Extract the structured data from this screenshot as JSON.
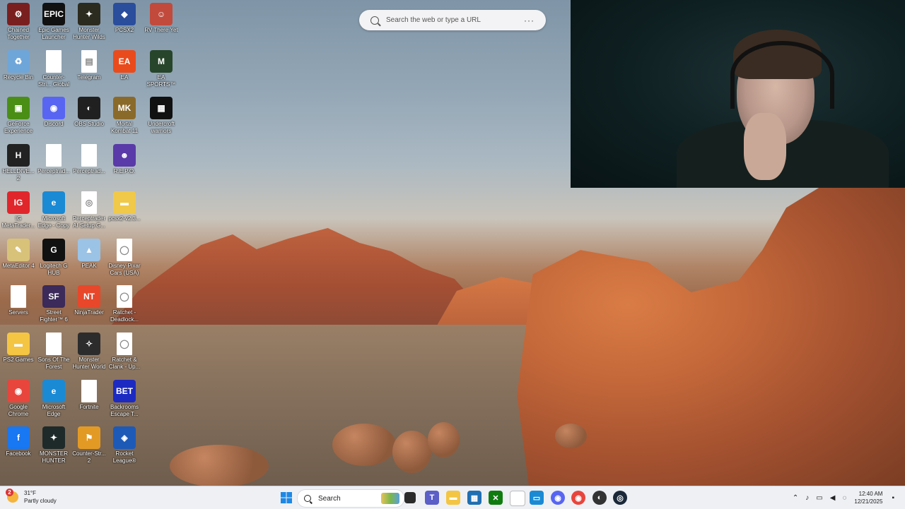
{
  "browser_search": {
    "placeholder": "Search the web or type a URL",
    "more": "···"
  },
  "desktop_icons": [
    {
      "label": "Chained Together",
      "glyph": "⚙",
      "bg": "#7a1f1f"
    },
    {
      "label": "Epic Games Launcher",
      "glyph": "EPIC",
      "bg": "#111111"
    },
    {
      "label": "Monster Hunter Wilds",
      "glyph": "✦",
      "bg": "#2b2b1f"
    },
    {
      "label": "PCSX2",
      "glyph": "◆",
      "bg": "#2a4d9c"
    },
    {
      "label": "RV There Yet",
      "glyph": "☺",
      "bg": "#c24a3c"
    },
    {
      "label": "Recycle Bin",
      "glyph": "♻",
      "bg": "#6fa6d9"
    },
    {
      "label": "Counter-Stri... Global Offe...",
      "glyph": "",
      "bg": "#ffffff"
    },
    {
      "label": "Telegram",
      "glyph": "▤",
      "bg": "#ffffff"
    },
    {
      "label": "EA",
      "glyph": "EA",
      "bg": "#ea4b1c"
    },
    {
      "label": "EA SPORTS™ Madden N...",
      "glyph": "M",
      "bg": "#27452a"
    },
    {
      "label": "GeForce Experience",
      "glyph": "▣",
      "bg": "#4a8e16"
    },
    {
      "label": "Discord",
      "glyph": "◉",
      "bg": "#5865f2"
    },
    {
      "label": "OBS Studio",
      "glyph": "◐",
      "bg": "#202020"
    },
    {
      "label": "Mortal Kombat 11",
      "glyph": "MK",
      "bg": "#8a6a2a"
    },
    {
      "label": "Undercroft warriors",
      "glyph": "▦",
      "bg": "#111111"
    },
    {
      "label": "HELLDIVE... 2",
      "glyph": "H",
      "bg": "#222222"
    },
    {
      "label": "Perceptrad...",
      "glyph": "",
      "bg": "#ffffff"
    },
    {
      "label": "Perceptrad...",
      "glyph": "",
      "bg": "#ffffff"
    },
    {
      "label": "R.E.P.O.",
      "glyph": "☻",
      "bg": "#5a3aa8"
    },
    {
      "label": "",
      "glyph": "",
      "bg": "transparent"
    },
    {
      "label": "IG MetaTrader...",
      "glyph": "IG",
      "bg": "#e0262b"
    },
    {
      "label": "Microsoft Edge - Copy",
      "glyph": "e",
      "bg": "#1a8ad4"
    },
    {
      "label": "Perceptrader AI Setup G...",
      "glyph": "◎",
      "bg": "#ffffff"
    },
    {
      "label": "pcsx2-v2.3...",
      "glyph": "▬",
      "bg": "#f0c94a"
    },
    {
      "label": "",
      "glyph": "",
      "bg": "transparent"
    },
    {
      "label": "MetaEditor 4",
      "glyph": "✎",
      "bg": "#d8c27a"
    },
    {
      "label": "Logitech G HUB",
      "glyph": "G",
      "bg": "#111111"
    },
    {
      "label": "PEAK",
      "glyph": "▲",
      "bg": "#9bc3e6"
    },
    {
      "label": "Disney·Pixar Cars (USA)",
      "glyph": "◯",
      "bg": "#ffffff"
    },
    {
      "label": "",
      "glyph": "",
      "bg": "transparent"
    },
    {
      "label": "Servers",
      "glyph": "",
      "bg": "#ffffff"
    },
    {
      "label": "Street Fighter™ 6",
      "glyph": "SF",
      "bg": "#3b2a5a"
    },
    {
      "label": "NinjaTrader",
      "glyph": "NT",
      "bg": "#e8472a"
    },
    {
      "label": "Ratchet - Deadlock...",
      "glyph": "◯",
      "bg": "#ffffff"
    },
    {
      "label": "",
      "glyph": "",
      "bg": "transparent"
    },
    {
      "label": "PS2 Games",
      "glyph": "▬",
      "bg": "#f4c542"
    },
    {
      "label": "Sons Of The Forest",
      "glyph": "",
      "bg": "#ffffff"
    },
    {
      "label": "Monster Hunter World",
      "glyph": "✧",
      "bg": "#2c2c2c"
    },
    {
      "label": "Ratchet & Clank - Up...",
      "glyph": "◯",
      "bg": "#ffffff"
    },
    {
      "label": "",
      "glyph": "",
      "bg": "transparent"
    },
    {
      "label": "Google Chrome",
      "glyph": "◉",
      "bg": "#e8453c"
    },
    {
      "label": "Microsoft Edge",
      "glyph": "e",
      "bg": "#1a8ad4"
    },
    {
      "label": "Fortnite",
      "glyph": "",
      "bg": "#ffffff"
    },
    {
      "label": "Backrooms Escape T...",
      "glyph": "BET",
      "bg": "#1c2ac2"
    },
    {
      "label": "",
      "glyph": "",
      "bg": "transparent"
    },
    {
      "label": "Facebook",
      "glyph": "f",
      "bg": "#1877f2"
    },
    {
      "label": "MONSTER HUNTER RI...",
      "glyph": "✦",
      "bg": "#1e2a2a"
    },
    {
      "label": "Counter-Str... 2",
      "glyph": "⚑",
      "bg": "#e39a25"
    },
    {
      "label": "Rocket League®",
      "glyph": "◈",
      "bg": "#1d5ab8"
    }
  ],
  "weather": {
    "temp": "31°F",
    "condition": "Partly cloudy",
    "badge": "2"
  },
  "taskbar": {
    "search_label": "Search"
  },
  "clock": {
    "time": "12:40 AM",
    "date": "12/21/2025"
  }
}
